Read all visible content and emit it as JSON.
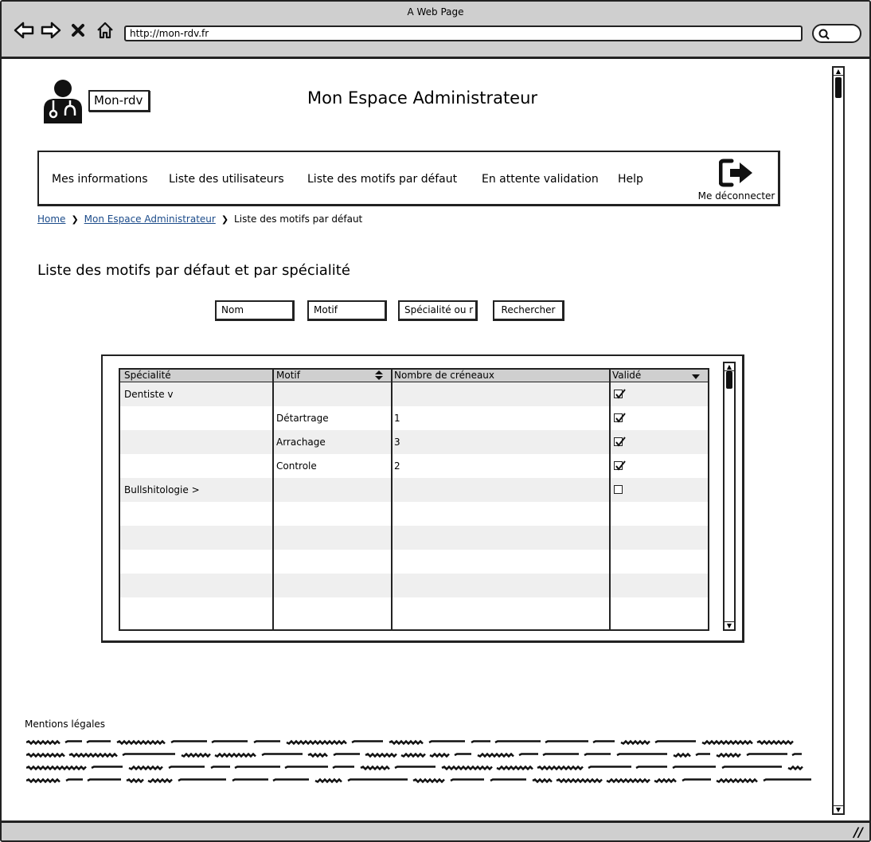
{
  "window": {
    "title": "A Web Page",
    "url": "http://mon-rdv.fr"
  },
  "header": {
    "brand": "Mon-rdv",
    "title": "Mon Espace Administrateur"
  },
  "nav": {
    "items": [
      {
        "label": "Mes informations"
      },
      {
        "label": "Liste des utilisateurs"
      },
      {
        "label": "Liste des motifs par défaut"
      },
      {
        "label": "En attente validation"
      },
      {
        "label": "Help"
      }
    ],
    "logout": {
      "label": "Me déconnecter",
      "icon": "logout-icon"
    }
  },
  "breadcrumb": {
    "home": "Home",
    "admin": "Mon Espace Administrateur",
    "current": "Liste des motifs par défaut"
  },
  "section": {
    "title": "Liste des motifs par défaut et par spécialité"
  },
  "filters": {
    "nom": "Nom",
    "motif": "Motif",
    "specialite": "Spécialité ou r",
    "search_button": "Rechercher"
  },
  "table": {
    "columns": [
      "Spécialité",
      "Motif",
      "Nombre de créneaux",
      "Validé"
    ],
    "rows": [
      {
        "specialite": "Dentiste v",
        "motif": "",
        "creneaux": "",
        "valide": true
      },
      {
        "specialite": "",
        "motif": "Détartrage",
        "creneaux": "1",
        "valide": true
      },
      {
        "specialite": "",
        "motif": "Arrachage",
        "creneaux": "3",
        "valide": true
      },
      {
        "specialite": "",
        "motif": "Controle",
        "creneaux": "2",
        "valide": true
      },
      {
        "specialite": "Bullshitologie >",
        "motif": "",
        "creneaux": "",
        "valide": false
      }
    ]
  },
  "footer": {
    "mentions": "Mentions légales"
  }
}
